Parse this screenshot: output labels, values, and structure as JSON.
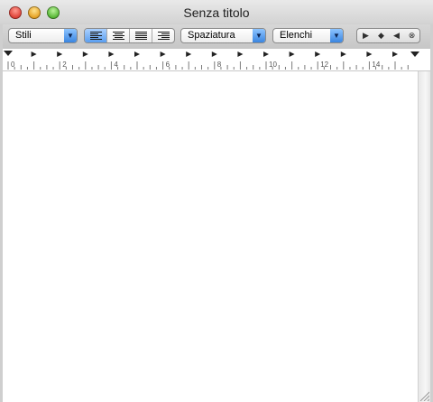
{
  "window": {
    "title": "Senza titolo"
  },
  "toolbar": {
    "styles_label": "Stili",
    "spacing_label": "Spaziatura",
    "lists_label": "Elenchi",
    "alignment_selected": "left"
  },
  "ruler": {
    "labels": [
      "0",
      "2",
      "4",
      "6",
      "8",
      "10",
      "12",
      "14"
    ]
  },
  "document": {
    "text": ""
  }
}
